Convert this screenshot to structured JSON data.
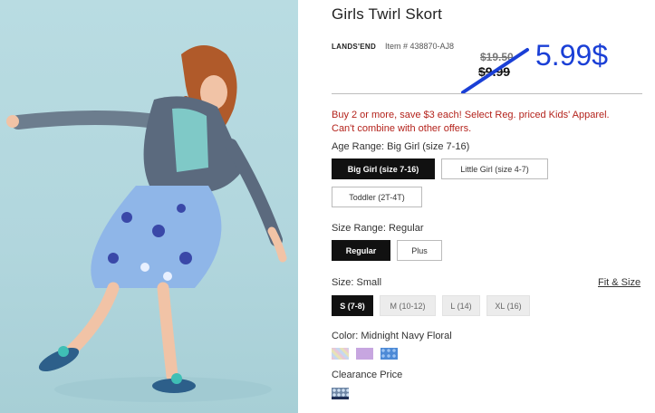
{
  "product": {
    "title": "Girls Twirl Skort",
    "brand": "LANDS'END",
    "item_number": "Item # 438870-AJ8",
    "original_price": "$19.50",
    "sale_price": "$9.99",
    "annotation_price": "5.99$"
  },
  "promo": {
    "line1": "Buy 2 or more, save $3 each! Select Reg. priced Kids' Apparel.",
    "line2": "Can't combine with other offers."
  },
  "age_range": {
    "label": "Age Range: Big Girl (size 7-16)",
    "options": [
      "Big Girl (size 7-16)",
      "Little Girl (size 4-7)",
      "Toddler (2T-4T)"
    ],
    "selected": "Big Girl (size 7-16)"
  },
  "size_range": {
    "label": "Size Range: Regular",
    "options": [
      "Regular",
      "Plus"
    ],
    "selected": "Regular"
  },
  "size": {
    "label": "Size: Small",
    "fit_link": "Fit & Size",
    "options": [
      "S (7-8)",
      "M (10-12)",
      "L (14)",
      "XL (16)"
    ],
    "selected": "S (7-8)"
  },
  "color": {
    "label": "Color: Midnight Navy Floral",
    "swatches": [
      {
        "name": "multi-floral-swatch",
        "color": "#d9c6e6"
      },
      {
        "name": "lavender-swatch",
        "color": "#c7a6e0"
      },
      {
        "name": "navy-dot-swatch",
        "color": "#4d8ad6"
      }
    ]
  },
  "clearance": {
    "label": "Clearance Price",
    "swatches": [
      {
        "name": "midnight-navy-floral-swatch",
        "color": "#6f87a6"
      }
    ]
  },
  "colors": {
    "promo_red": "#b4231c",
    "annotation_blue": "#1a3fd6",
    "selected_black": "#111111"
  }
}
